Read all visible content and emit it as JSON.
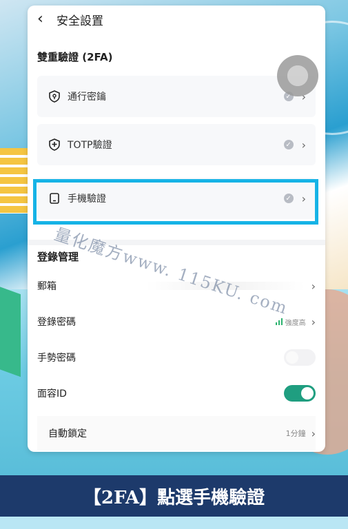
{
  "header": {
    "title": "安全設置",
    "back_icon": "chevron-left-icon"
  },
  "two_factor": {
    "section_title": "雙重驗證 (2FA)",
    "items": [
      {
        "label": "通行密鑰",
        "icon": "passkey-shield-icon"
      },
      {
        "label": "TOTP驗證",
        "icon": "totp-shield-icon"
      },
      {
        "label": "手機驗證",
        "icon": "phone-icon"
      }
    ]
  },
  "login": {
    "section_title": "登錄管理",
    "email_label": "郵箱",
    "password_label": "登錄密碼",
    "password_strength": "強度高",
    "gesture_label": "手勢密碼",
    "gesture_enabled": false,
    "faceid_label": "面容ID",
    "faceid_enabled": true,
    "autolock_label": "自動鎖定",
    "autolock_value": "1分鐘"
  },
  "watermark": "量化魔方www. 115KU. com",
  "caption": "【2FA】點選手機驗證",
  "colors": {
    "highlight": "#16b3e6",
    "toggle_on": "#1f9e80",
    "banner": "#1d3a6b"
  }
}
